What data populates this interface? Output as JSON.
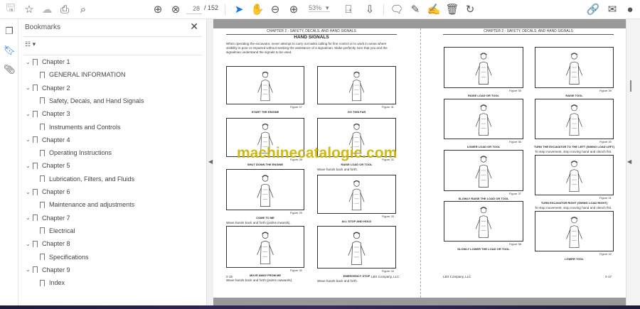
{
  "toolbar": {
    "page_current": "28",
    "page_total": "/ 152",
    "zoom": "53%",
    "icons": [
      "save-icon",
      "star-icon",
      "upload-icon",
      "print-icon",
      "zoom-search-icon",
      "page-up-icon",
      "page-down-icon",
      "select-cursor-icon",
      "hand-icon",
      "zoom-out-icon",
      "zoom-in-icon",
      "page-fit-icon",
      "scroll-mode-icon",
      "comment-icon",
      "highlight-icon",
      "sign-icon",
      "delete-icon",
      "rotate-icon",
      "share-link-icon",
      "email-icon",
      "account-icon"
    ]
  },
  "rail": {
    "icons": [
      "pages-icon",
      "bookmarks-icon",
      "attachments-icon"
    ]
  },
  "bookmarks": {
    "title": "Bookmarks",
    "items": [
      {
        "label": "Chapter 1",
        "level": 0
      },
      {
        "label": "GENERAL INFORMATION",
        "level": 1
      },
      {
        "label": "Chapter 2",
        "level": 0
      },
      {
        "label": "Safety, Decals, and Hand Signals",
        "level": 1
      },
      {
        "label": "Chapter 3",
        "level": 0
      },
      {
        "label": "Instruments and Controls",
        "level": 1
      },
      {
        "label": "Chapter 4",
        "level": 0
      },
      {
        "label": "Operating Instructions",
        "level": 1
      },
      {
        "label": "Chapter 5",
        "level": 0
      },
      {
        "label": "Lubrication, Filters, and Fluids",
        "level": 1
      },
      {
        "label": "Chapter 6",
        "level": 0
      },
      {
        "label": "Maintenance and adjustments",
        "level": 1
      },
      {
        "label": "Chapter 7",
        "level": 0
      },
      {
        "label": "Electrical",
        "level": 1
      },
      {
        "label": "Chapter 8",
        "level": 0
      },
      {
        "label": "Specifications",
        "level": 1
      },
      {
        "label": "Chapter 9",
        "level": 0
      },
      {
        "label": "Index",
        "level": 1
      }
    ]
  },
  "left_page": {
    "header": "CHAPTER 2 - SAFETY, DECALS, AND HAND SIGNALS",
    "title": "HAND SIGNALS",
    "intro": "When operating the excavator, never attempt to carry out tasks calling for fine control or to work in areas where visibility is poor or impaired without seeking the assistance of a signalman. Make perfectly sure that you and the signalman understand the signals to be used.",
    "figures": [
      {
        "caption": "START THE ENGINE",
        "figure": "Figure 27",
        "desc": ""
      },
      {
        "caption": "GO THIS FAR",
        "figure": "Figure 31",
        "desc": ""
      },
      {
        "caption": "SHUT DOWN THE ENGINE",
        "figure": "Figure 28",
        "desc": ""
      },
      {
        "caption": "RAISE LOAD OR TOOL",
        "figure": "Figure 32",
        "desc": "Wave hands back and forth."
      },
      {
        "caption": "COME TO ME",
        "figure": "Figure 29",
        "desc": "Wave hands back and forth (palms inwards)."
      },
      {
        "caption": "ALL STOP AND HOLD",
        "figure": "Figure 33",
        "desc": ""
      },
      {
        "caption": "MOVE AWAY FROM ME",
        "figure": "Figure 30",
        "desc": "Wave hands back and forth (palms outwards)."
      },
      {
        "caption": "EMERGENCY STOP",
        "figure": "Figure 34",
        "desc": "Wave hands back and forth."
      }
    ],
    "page_number": "2-16",
    "company": "LBX Company, LLC"
  },
  "right_page": {
    "header": "CHAPTER 2 - SAFETY, DECALS, AND HAND SIGNALS",
    "figures": [
      {
        "caption": "RAISE LOAD OR TOOL",
        "figure": "Figure 35",
        "desc": ""
      },
      {
        "caption": "RAISE TOOL",
        "figure": "Figure 39",
        "desc": ""
      },
      {
        "caption": "LOWER LOAD OR TOOL",
        "figure": "Figure 36",
        "desc": ""
      },
      {
        "caption": "TURN THE EXCAVATOR TO THE LEFT (SWING LOAD LEFT)",
        "figure": "Figure 40",
        "desc": "To stop movement, stop moving hand and clench fist."
      },
      {
        "caption": "SLOWLY RAISE THE LOAD OR TOOL",
        "figure": "Figure 37",
        "desc": ""
      },
      {
        "caption": "TURN EXCAVATOR RIGHT (SWING LOAD RIGHT)",
        "figure": "Figure 41",
        "desc": "To stop movement, stop moving hand and clench fist."
      },
      {
        "caption": "SLOWLY LOWER THE LOAD OR TOOL",
        "figure": "Figure 38",
        "desc": ""
      },
      {
        "caption": "LOWER TOOL",
        "figure": "Figure 42",
        "desc": ""
      }
    ],
    "page_number": "2-17",
    "company": "LBX Company, LLC"
  },
  "watermark": "machinecatalogic.com"
}
